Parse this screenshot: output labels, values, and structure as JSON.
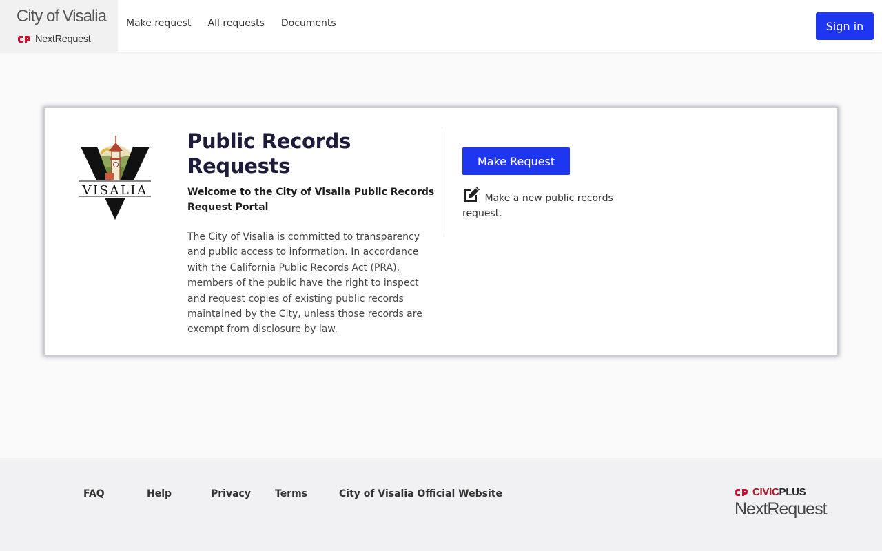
{
  "header": {
    "city_name": "City of Visalia",
    "product_name": "NextRequest",
    "nav": [
      "Make request",
      "All requests",
      "Documents"
    ],
    "signin_label": "Sign in"
  },
  "card": {
    "logo_text": "VISALIA",
    "title": "Public Records Requests",
    "welcome": "Welcome to the City of Visalia Public Records Request Portal",
    "description": "The City of Visalia is committed to transparency and public access to information. In accordance with the California Public Records Act (PRA), members of the public have the right to inspect and request copies of existing public records maintained by the City, unless those records are exempt from disclosure by law.",
    "make_request_label": "Make Request",
    "make_request_desc": "Make a new public records request."
  },
  "footer": {
    "links": [
      "FAQ",
      "Help",
      "Privacy",
      "Terms",
      "City of Visalia Official Website"
    ],
    "brand_civic": "CIVIC",
    "brand_plus": "PLUS",
    "brand_product": "NextRequest"
  },
  "colors": {
    "primary": "#1f36f0",
    "brand_red": "#b01624",
    "title_navy": "#1c1c3a"
  },
  "icons": [
    "civicplus-logo-icon",
    "visalia-logo",
    "edit-icon"
  ]
}
